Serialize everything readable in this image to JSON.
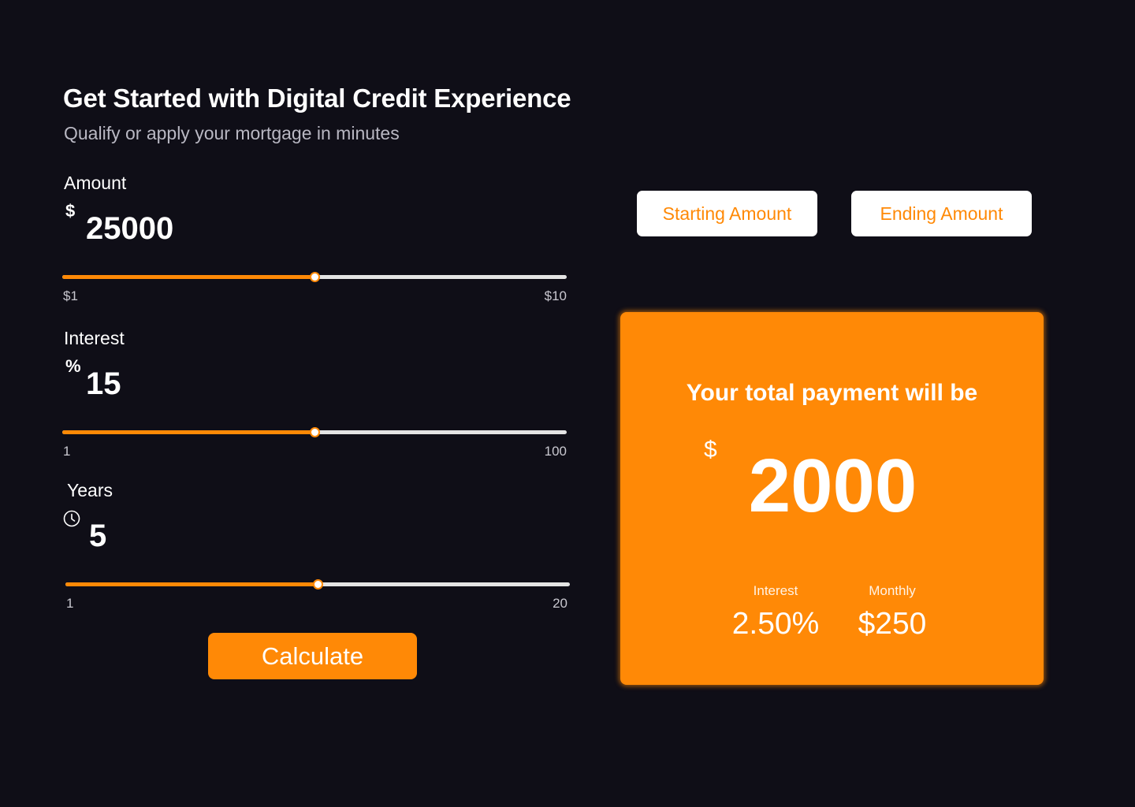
{
  "header": {
    "title": "Get Started with Digital Credit Experience",
    "subtitle": "Qualify or apply your mortgage in minutes"
  },
  "amount": {
    "label": "Amount",
    "unit": "$",
    "value": "25000",
    "min_label": "$1",
    "max_label": "$10",
    "slider_fraction": 0.5
  },
  "interest": {
    "label": "Interest",
    "unit": "%",
    "value": "15",
    "min_label": "1",
    "max_label": "100",
    "slider_fraction": 0.5
  },
  "years": {
    "label": "Years",
    "icon": "clock-icon",
    "value": "5",
    "min_label": "1",
    "max_label": "20",
    "slider_fraction": 0.5
  },
  "actions": {
    "calculate_label": "Calculate",
    "starting_amount_label": "Starting Amount",
    "ending_amount_label": "Ending Amount"
  },
  "result": {
    "heading": "Your total payment will be",
    "currency": "$",
    "total": "2000",
    "interest_label": "Interest",
    "interest_value": "2.50%",
    "monthly_label": "Monthly",
    "monthly_value": "$250"
  },
  "colors": {
    "background": "#0f0e17",
    "accent": "#ff8906",
    "track": "#e4e4e4",
    "muted_text": "#b9b8c3"
  }
}
